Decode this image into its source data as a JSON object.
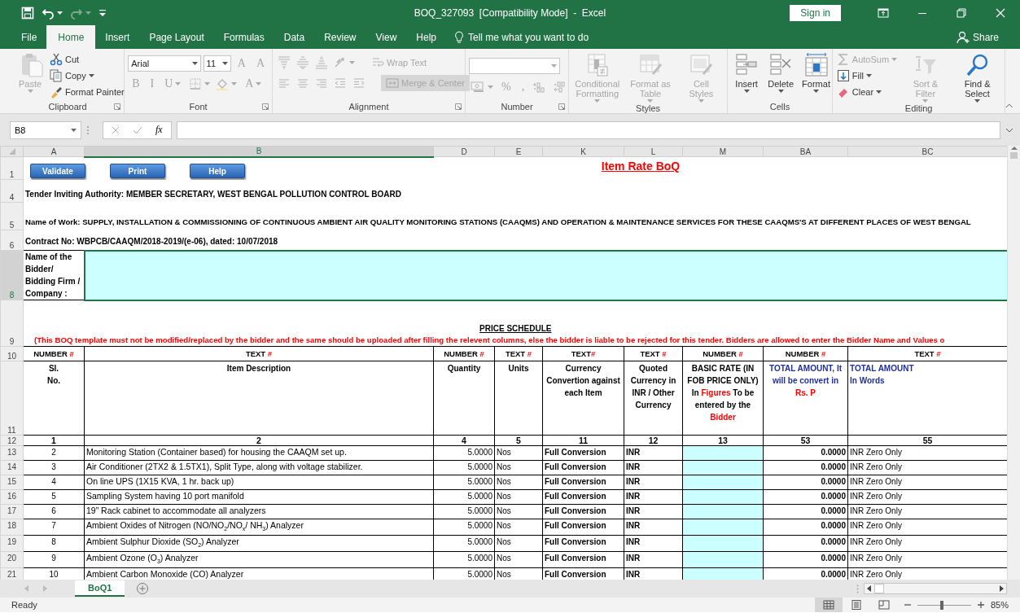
{
  "window": {
    "title": "BOQ_327093  [Compatibility Mode]  -  Excel",
    "sign_in": "Sign in"
  },
  "quick_access": [
    {
      "kind": "save",
      "disabled": false,
      "dropdown": false
    },
    {
      "kind": "undo",
      "disabled": false,
      "dropdown": true
    },
    {
      "kind": "redo",
      "disabled": true,
      "dropdown": true
    },
    {
      "kind": "customize",
      "disabled": false,
      "dropdown": false
    }
  ],
  "ribbon_tabs": [
    {
      "label": "File",
      "selected": false
    },
    {
      "label": "Home",
      "selected": true
    },
    {
      "label": "Insert",
      "selected": false
    },
    {
      "label": "Page Layout",
      "selected": false
    },
    {
      "label": "Formulas",
      "selected": false
    },
    {
      "label": "Data",
      "selected": false
    },
    {
      "label": "Review",
      "selected": false
    },
    {
      "label": "View",
      "selected": false
    },
    {
      "label": "Help",
      "selected": false
    }
  ],
  "tell_me": "Tell me what you want to do",
  "share": "Share",
  "ribbon_groups": [
    {
      "label": "Clipboard",
      "launcher": true,
      "columns": [
        [
          {
            "kind": "large",
            "label": "Paste",
            "disabled": true,
            "dropdown": true
          }
        ],
        [
          {
            "kind": "small",
            "label": "Cut",
            "disabled": false,
            "dropdown": false
          },
          {
            "kind": "small",
            "label": "Copy",
            "disabled": false,
            "dropdown": true
          },
          {
            "kind": "small",
            "label": "Format Painter",
            "disabled": false,
            "dropdown": false
          }
        ]
      ]
    },
    {
      "label": "Font",
      "launcher": true,
      "rows": [
        [
          {
            "kind": "font-field",
            "value": "Arial",
            "disabled": false,
            "dropdown": true
          },
          {
            "kind": "size-field",
            "value": "11",
            "disabled": false,
            "dropdown": true
          },
          {
            "kind": "glyph",
            "label": "A",
            "disabled": true,
            "dropdown": false
          },
          {
            "kind": "glyph",
            "label": "A",
            "disabled": true,
            "dropdown": false
          }
        ],
        [
          {
            "kind": "glyph",
            "label": "B",
            "disabled": true,
            "dropdown": false
          },
          {
            "kind": "glyph",
            "label": "I",
            "disabled": true,
            "dropdown": false
          },
          {
            "kind": "glyph",
            "label": "U",
            "disabled": true,
            "dropdown": true
          },
          {
            "kind": "icon",
            "disabled": true,
            "dropdown": true
          },
          {
            "kind": "icon",
            "disabled": true,
            "dropdown": true
          },
          {
            "kind": "glyph",
            "label": "A",
            "disabled": true,
            "dropdown": true
          }
        ]
      ]
    },
    {
      "label": "Alignment",
      "launcher": true,
      "rows": [
        [
          {
            "kind": "icon",
            "disabled": true,
            "dropdown": false
          },
          {
            "kind": "icon",
            "disabled": true,
            "dropdown": false
          },
          {
            "kind": "icon",
            "disabled": true,
            "dropdown": false
          },
          {
            "kind": "icon",
            "disabled": true,
            "dropdown": true
          },
          {
            "kind": "small",
            "label": "Wrap Text",
            "disabled": true,
            "dropdown": false
          }
        ],
        [
          {
            "kind": "icon",
            "disabled": true,
            "dropdown": false
          },
          {
            "kind": "icon",
            "disabled": true,
            "dropdown": false
          },
          {
            "kind": "icon",
            "disabled": true,
            "dropdown": false
          },
          {
            "kind": "icon",
            "disabled": true,
            "dropdown": false
          },
          {
            "kind": "icon",
            "disabled": true,
            "dropdown": false
          },
          {
            "kind": "merge",
            "label": "Merge & Center",
            "disabled": true,
            "dropdown": false
          }
        ]
      ]
    },
    {
      "label": "Number",
      "launcher": true,
      "rows": [
        [
          {
            "kind": "format-field",
            "disabled": true,
            "dropdown": true
          }
        ],
        [
          {
            "kind": "icon",
            "disabled": true,
            "dropdown": true
          },
          {
            "kind": "glyph",
            "label": "%",
            "disabled": true,
            "dropdown": false
          },
          {
            "kind": "glyph",
            "label": ",",
            "disabled": true,
            "dropdown": false
          },
          {
            "kind": "icon",
            "disabled": true,
            "dropdown": false
          },
          {
            "kind": "icon",
            "disabled": true,
            "dropdown": false
          }
        ]
      ]
    },
    {
      "label": "Styles",
      "launcher": false,
      "columns": [
        [
          {
            "kind": "large",
            "label": "Conditional Formatting",
            "disabled": true,
            "dropdown": true
          }
        ],
        [
          {
            "kind": "large",
            "label": "Format as Table",
            "disabled": true,
            "dropdown": true
          }
        ],
        [
          {
            "kind": "large",
            "label": "Cell Styles",
            "disabled": true,
            "dropdown": true
          }
        ]
      ]
    },
    {
      "label": "Cells",
      "launcher": false,
      "columns": [
        [
          {
            "kind": "large",
            "label": "Insert",
            "disabled": false,
            "dropdown": true
          }
        ],
        [
          {
            "kind": "large",
            "label": "Delete",
            "disabled": false,
            "dropdown": true
          }
        ],
        [
          {
            "kind": "large",
            "label": "Format",
            "disabled": false,
            "dropdown": true
          }
        ]
      ]
    },
    {
      "label": "Editing",
      "launcher": false,
      "columns": [
        [
          {
            "kind": "small",
            "label": "AutoSum",
            "disabled": true,
            "dropdown": true
          },
          {
            "kind": "small",
            "label": "Fill",
            "disabled": false,
            "dropdown": true
          },
          {
            "kind": "small",
            "label": "Clear",
            "disabled": false,
            "dropdown": true
          }
        ],
        [
          {
            "kind": "large",
            "label": "Sort & Filter",
            "disabled": true,
            "dropdown": true
          }
        ],
        [
          {
            "kind": "large",
            "label": "Find & Select",
            "disabled": false,
            "dropdown": true
          }
        ]
      ]
    }
  ],
  "formula_bar": {
    "name_box": "B8",
    "fx": "fx"
  },
  "sheet": {
    "columns": [
      {
        "label": "A",
        "selected": false
      },
      {
        "label": "B",
        "selected": true
      },
      {
        "label": "D",
        "selected": false
      },
      {
        "label": "E",
        "selected": false
      },
      {
        "label": "K",
        "selected": false
      },
      {
        "label": "L",
        "selected": false
      },
      {
        "label": "M",
        "selected": false
      },
      {
        "label": "BA",
        "selected": false
      },
      {
        "label": "BC",
        "selected": false
      }
    ],
    "top": {
      "row": "1",
      "buttons": [
        "Validate",
        "Print",
        "Help"
      ],
      "title": "Item Rate BoQ"
    },
    "info": [
      {
        "row": "4",
        "text": "Tender Inviting Authority: MEMBER SECRETARY, WEST BENGAL POLLUTION CONTROL BOARD"
      },
      {
        "row": "5",
        "text": "Name of Work: SUPPLY, INSTALLATION & COMMISSIONING OF CONTINUOUS AMBIENT AIR QUALITY MONITORING STATIONS (CAAQMS) AND OPERATION & MAINTENANCE SERVICES FOR THESE CAAQMS'S AT DIFFERENT PLACES OF WEST BENGAL"
      },
      {
        "row": "6",
        "text": "Contract No:  WBPCB/CAAQM/2018-2019/(e-06), dated: 10/07/2018"
      }
    ],
    "bidder": {
      "row": "8",
      "label": "Name of the Bidder/ Bidding Firm / Company :",
      "selected": true
    },
    "schedule": {
      "row": "9",
      "title": "PRICE SCHEDULE",
      "notice": "(This BOQ template must not be modified/replaced by the bidder and the same should be uploaded after filling the relevent columns, else the bidder is liable to be rejected for this tender. Bidders are allowed to enter the Bidder Name and Values o"
    },
    "types": {
      "row": "10",
      "cells": [
        {
          "type": "NUMBER",
          "mark": "#"
        },
        {
          "type": "TEXT",
          "mark": "#"
        },
        {
          "type": "NUMBER",
          "mark": "#"
        },
        {
          "type": "TEXT",
          "mark": "#"
        },
        {
          "type": "TEXT",
          "mark": "#",
          "joined": true
        },
        {
          "type": "TEXT",
          "mark": "#"
        },
        {
          "type": "NUMBER",
          "mark": "#"
        },
        {
          "type": "NUMBER",
          "mark": "#"
        },
        {
          "type": "TEXT",
          "mark": "#"
        }
      ]
    },
    "headings": {
      "row": "11",
      "cells": [
        [
          {
            "text": "Sl.\nNo.",
            "color": "#000000"
          }
        ],
        [
          {
            "text": "Item Description",
            "color": "#000000"
          }
        ],
        [
          {
            "text": "Quantity",
            "color": "#000000"
          }
        ],
        [
          {
            "text": "Units",
            "color": "#000000"
          }
        ],
        [
          {
            "text": "Currency Convertion against each Item",
            "color": "#000000"
          }
        ],
        [
          {
            "text": "Quoted Currency in INR / Other Currency",
            "color": "#000000"
          }
        ],
        [
          {
            "text": "BASIC RATE (IN FOB PRICE ONLY) In ",
            "color": "#000000"
          },
          {
            "text": "Figures",
            "color": "#ff0000"
          },
          {
            "text": " To be entered by the ",
            "color": "#000000"
          },
          {
            "text": "Bidder",
            "color": "#ff0000"
          }
        ],
        [
          {
            "text": "TOTAL AMOUNT, It will be convert in ",
            "color": "#1f2fa0"
          },
          {
            "text": "Rs.     P",
            "color": "#ff0000"
          }
        ],
        [
          {
            "text": "TOTAL AMOUNT\nIn Words",
            "color": "#1f2fa0"
          }
        ]
      ]
    },
    "numbers": {
      "row": "12",
      "cells": [
        "1",
        "2",
        "4",
        "5",
        "11",
        "12",
        "13",
        "53",
        "55"
      ]
    },
    "items": [
      {
        "row": "13",
        "sl": "2",
        "description": "Monitoring Station (Container based) for housing the CAAQM set up.",
        "quantity": "5.0000",
        "units": "Nos",
        "conversion": "Full Conversion",
        "currency": "INR",
        "total": "0.0000",
        "words": "INR Zero Only"
      },
      {
        "row": "14",
        "sl": "3",
        "description": "Air Conditioner (2TX2 & 1.5TX1), Split Type, along with voltage stabilizer.",
        "quantity": "5.0000",
        "units": "Nos",
        "conversion": "Full Conversion",
        "currency": "INR",
        "total": "0.0000",
        "words": "INR Zero Only"
      },
      {
        "row": "15",
        "sl": "4",
        "description": "On line UPS (1X15 KVA, 1 hr. back up)",
        "quantity": "5.0000",
        "units": "Nos",
        "conversion": "Full Conversion",
        "currency": "INR",
        "total": "0.0000",
        "words": "INR Zero Only"
      },
      {
        "row": "16",
        "sl": "5",
        "description": "Sampling System having 10 port manifold",
        "quantity": "5.0000",
        "units": "Nos",
        "conversion": "Full Conversion",
        "currency": "INR",
        "total": "0.0000",
        "words": "INR Zero Only"
      },
      {
        "row": "17",
        "sl": "6",
        "description": "19” Rack cabinet to accommodate all analyzers",
        "quantity": "5.0000",
        "units": "Nos",
        "conversion": "Full Conversion",
        "currency": "INR",
        "total": "0.0000",
        "words": "INR Zero Only"
      },
      {
        "row": "18",
        "sl": "7",
        "description": "Ambient Oxides of Nitrogen (NO/NO$_{2}$/NO$_{x}$/ NH$_{3}$) Analyzer",
        "quantity": "5.0000",
        "units": "Nos",
        "conversion": "Full Conversion",
        "currency": "INR",
        "total": "0.0000",
        "words": "INR Zero Only"
      },
      {
        "row": "19",
        "sl": "8",
        "description": "Ambient Sulphur Dioxide (SO$_{2}$) Analyzer",
        "quantity": "5.0000",
        "units": "Nos",
        "conversion": "Full Conversion",
        "currency": "INR",
        "total": "0.0000",
        "words": "INR Zero Only"
      },
      {
        "row": "20",
        "sl": "9",
        "description": "Ambient Ozone (O$_{3}$) Analyzer",
        "quantity": "5.0000",
        "units": "Nos",
        "conversion": "Full Conversion",
        "currency": "INR",
        "total": "0.0000",
        "words": "INR Zero Only"
      },
      {
        "row": "21",
        "sl": "10",
        "description": "Ambient Carbon Monoxide (CO) Analyzer",
        "quantity": "5.0000",
        "units": "Nos",
        "conversion": "Full Conversion",
        "currency": "INR",
        "total": "0.0000",
        "words": "INR Zero Only"
      }
    ]
  },
  "sheet_tabs": [
    {
      "label": "BoQ1",
      "selected": true
    }
  ],
  "status": {
    "text": "Ready",
    "views": [
      {
        "selected": true
      },
      {
        "selected": false
      },
      {
        "selected": false
      }
    ],
    "zoom": {
      "level": 0.45,
      "reading": "85%"
    }
  }
}
